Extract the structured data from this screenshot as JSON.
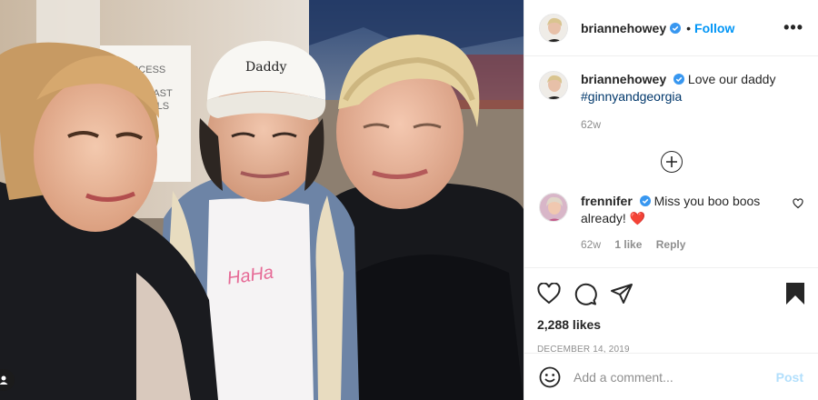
{
  "post": {
    "username": "briannehowey",
    "follow_label": "Follow",
    "caption_text": "Love our daddy",
    "hashtag": "#ginnyandgeorgia",
    "caption_time": "62w",
    "likes": "2,288 likes",
    "date": "DECEMBER 14, 2019"
  },
  "photo": {
    "cap_text": "Daddy",
    "sign_line1": "O ACCESS",
    "sign_line2": "S CAST",
    "sign_line3": "RSALS",
    "shirt_text": "HaHa"
  },
  "comments": [
    {
      "username": "frennifer",
      "text": "Miss you boo boos already!",
      "emoji": "❤️",
      "time": "62w",
      "likes": "1 like",
      "reply": "Reply"
    }
  ],
  "add_comment": {
    "placeholder": "Add a comment...",
    "post_label": "Post"
  },
  "colors": {
    "accent": "#0095f6",
    "verified": "#3897f0",
    "post_disabled": "#b2dffc"
  }
}
